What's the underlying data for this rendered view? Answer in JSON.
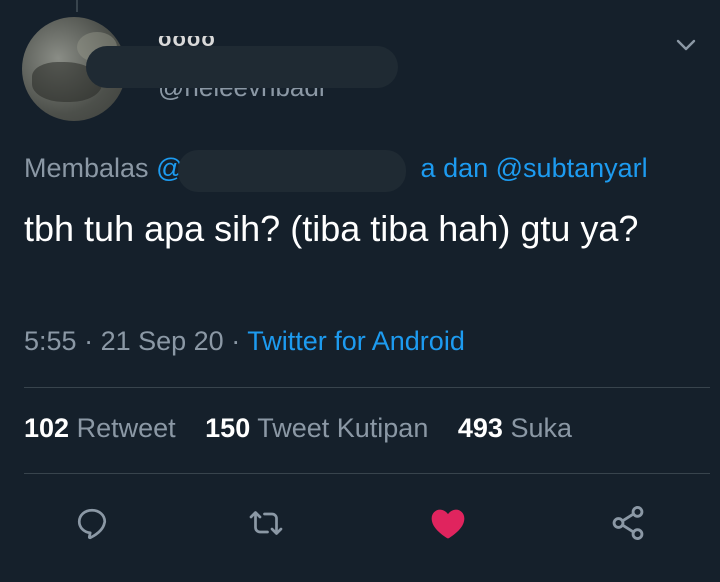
{
  "author": {
    "name_partial": "oooo",
    "handle_partial": "@heleevnbadi"
  },
  "reply": {
    "prefix": "Membalas",
    "mention_start": "@",
    "mention_end": "a",
    "connector": "dan",
    "second_mention": "@subtanyarl"
  },
  "tweet": {
    "text": "tbh tuh apa sih? (tiba tiba hah) gtu ya?",
    "time": "5:55",
    "date": "21 Sep 20",
    "source": "Twitter for Android"
  },
  "stats": {
    "retweets_count": "102",
    "retweets_label": "Retweet",
    "quotes_count": "150",
    "quotes_label": "Tweet Kutipan",
    "likes_count": "493",
    "likes_label": "Suka"
  },
  "actions": {
    "reply_icon": "reply-icon",
    "retweet_icon": "retweet-icon",
    "like_icon": "heart-icon",
    "share_icon": "share-icon",
    "like_color": "#e0245e",
    "icon_color": "#8b98a5",
    "link_color": "#1d9bf0"
  }
}
